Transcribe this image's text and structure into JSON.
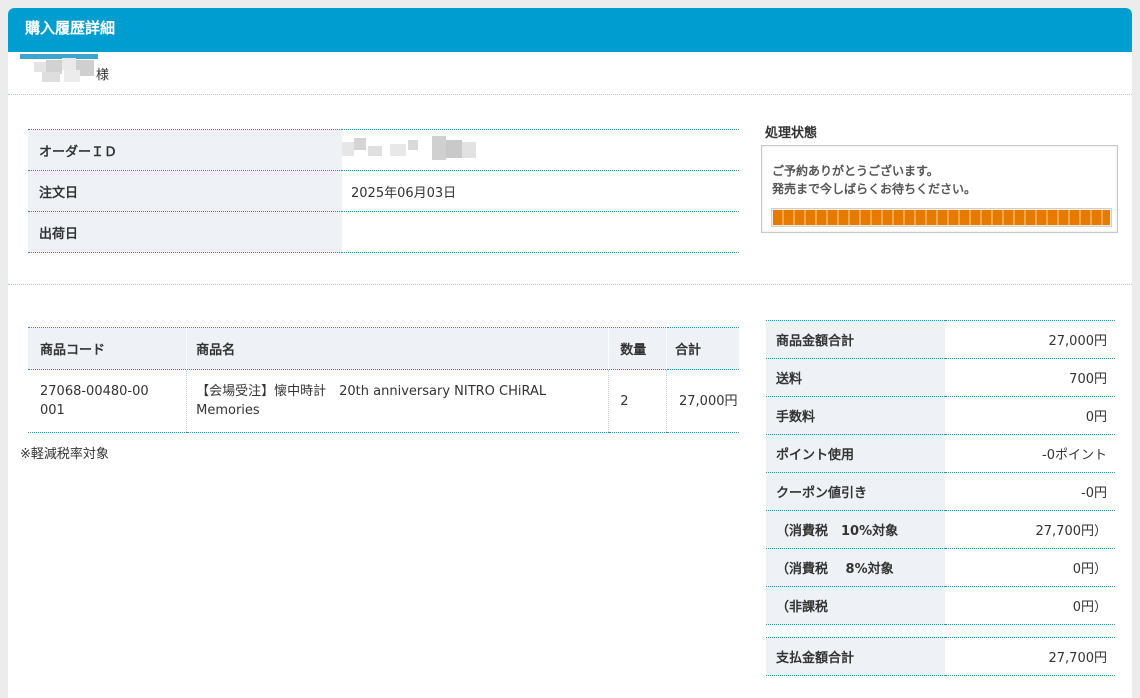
{
  "header": {
    "title": "購入履歴詳細"
  },
  "customer": {
    "suffix": "様"
  },
  "order": {
    "rows": [
      {
        "label": "オーダーＩＤ",
        "value": ""
      },
      {
        "label": "注文日",
        "value": "2025年06月03日"
      },
      {
        "label": "出荷日",
        "value": ""
      }
    ]
  },
  "status": {
    "title": "処理状態",
    "line1": "ご予約ありがとうございます。",
    "line2": "発売まで今しばらくお待ちください。",
    "progress": 1.0,
    "colors": {
      "accent": "#009ed0",
      "progress": "#e77a00"
    }
  },
  "items": {
    "headers": [
      "商品コード",
      "商品名",
      "数量",
      "合計"
    ],
    "rows": [
      {
        "code": "27068-00480-00001",
        "name": "【会場受注】懐中時計　20th anniversary NITRO CHiRAL Memories",
        "qty": "2",
        "total": "27,000円"
      }
    ],
    "note": "※軽減税率対象"
  },
  "summary": {
    "rows": [
      {
        "label": "商品金額合計",
        "value": "27,000円"
      },
      {
        "label": "送料",
        "value": "700円"
      },
      {
        "label": "手数料",
        "value": "0円"
      },
      {
        "label": "ポイント使用",
        "value": "-0ポイント"
      },
      {
        "label": "クーポン値引き",
        "value": "-0円"
      },
      {
        "label": "（消費税　10%対象",
        "value": "27,700円）"
      },
      {
        "label": "（消費税　 8%対象",
        "value": "0円）"
      },
      {
        "label": "（非課税",
        "value": "0円）"
      }
    ],
    "total_label": "支払金額合計",
    "total_value": "27,700円"
  }
}
